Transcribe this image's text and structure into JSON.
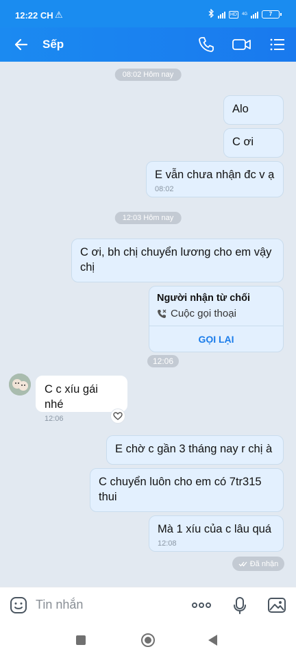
{
  "status_bar": {
    "time": "12:22 CH",
    "warning_icon": "warning-icon",
    "network": "4G",
    "hd_badge": "HD",
    "battery": "7"
  },
  "header": {
    "title": "Sếp",
    "icons": [
      "back-arrow-icon",
      "phone-icon",
      "video-call-icon",
      "menu-icon"
    ]
  },
  "chat": {
    "separators": [
      "08:02 Hôm nay",
      "12:03 Hôm nay"
    ],
    "messages": [
      {
        "text": "Alo"
      },
      {
        "text": "C ơi"
      },
      {
        "text": "E vẫn chưa nhận đc v ạ",
        "time": "08:02"
      },
      {
        "text": "C ơi, bh chị chuyển lương cho em vậy chị"
      },
      {
        "text": "C c xíu gái nhé",
        "time": "12:06"
      },
      {
        "text": "E chờ c gần 3 tháng nay r chị à"
      },
      {
        "text": "C chuyển luôn cho em có 7tr315 thui"
      },
      {
        "text": "Mà 1 xíu của c lâu quá",
        "time": "12:08"
      }
    ],
    "call_card": {
      "title": "Người nhận từ chối",
      "subtitle": "Cuộc gọi thoại",
      "action": "GỌI LẠI",
      "time": "12:06"
    },
    "seen_label": "Đã nhận"
  },
  "input": {
    "placeholder": "Tin nhắn"
  },
  "colors": {
    "accent": "#1a8cf0",
    "bubble_out": "#e3f0fe",
    "chat_bg": "#e2e9f1"
  }
}
